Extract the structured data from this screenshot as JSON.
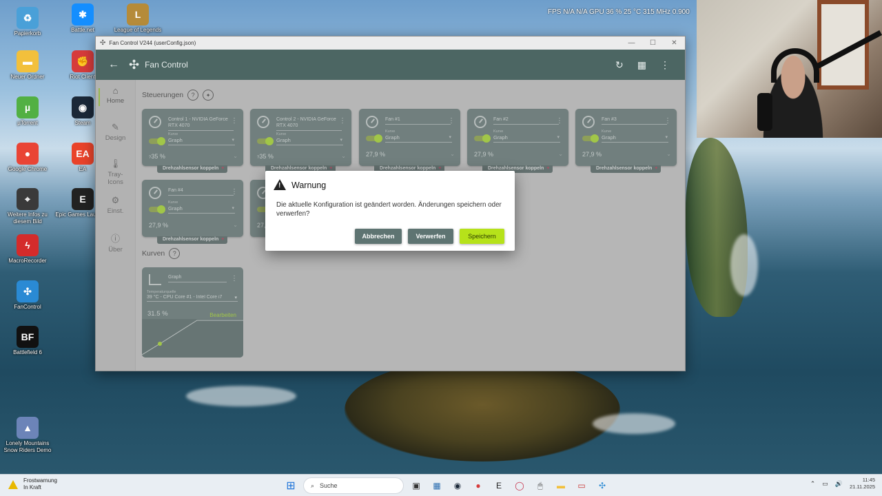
{
  "overlay": {
    "stats_text": "FPS  N/A  N/A    GPU  36 %  25 °C  315 MHz  0.900"
  },
  "desktop_icons": [
    {
      "label": "Papierkorb",
      "color": "#4aa0d8",
      "glyph": "♻"
    },
    {
      "label": "Battle.net",
      "color": "#148eff",
      "glyph": "✱"
    },
    {
      "label": "League of Legends",
      "color": "#b58b3a",
      "glyph": "L"
    },
    {
      "label": "Neuer Ordner",
      "color": "#f2c03c",
      "glyph": "▬"
    },
    {
      "label": "Riot Client",
      "color": "#d63b3b",
      "glyph": "✊"
    },
    {
      "label": "µTorrent",
      "color": "#52b043",
      "glyph": "µ"
    },
    {
      "label": "Steam",
      "color": "#1b2838",
      "glyph": "◉"
    },
    {
      "label": "Google Chrome",
      "color": "#e94435",
      "glyph": "●"
    },
    {
      "label": "EA",
      "color": "#e9432a",
      "glyph": "EA"
    },
    {
      "label": "Weitere Infos zu diesem Bild",
      "color": "#3a3a3a",
      "glyph": "⌖"
    },
    {
      "label": "Epic Games Launcher",
      "color": "#222222",
      "glyph": "E"
    },
    {
      "label": "MacroRecorder",
      "color": "#d42b2b",
      "glyph": "ϟ"
    },
    {
      "label": "FanControl",
      "color": "#2a8ad4",
      "glyph": "✣"
    },
    {
      "label": "Battlefield 6",
      "color": "#111111",
      "glyph": "BF"
    },
    {
      "label": "Lonely Mountains Snow Riders Demo",
      "color": "#6c84b8",
      "glyph": "▲"
    }
  ],
  "window": {
    "title": "Fan Control V244 (userConfig.json)",
    "controls": [
      "—",
      "☐",
      "✕"
    ]
  },
  "appbar": {
    "title": "Fan Control",
    "back": "←",
    "logo": "✣",
    "refresh": "↻",
    "layout": "▦",
    "menu": "⋮"
  },
  "rail": [
    {
      "label": "Home",
      "icon": "⌂"
    },
    {
      "label": "Design",
      "icon": "✎"
    },
    {
      "label": "Tray-Icons",
      "icon": "🌡"
    },
    {
      "label": "Einst.",
      "icon": "⚙"
    },
    {
      "label": "Über",
      "icon": "ⓘ"
    }
  ],
  "sections": {
    "controls_title": "Steuerungen",
    "curves_title": "Kurven",
    "help": "?",
    "wrench": "🔧"
  },
  "controls": [
    {
      "name": "Control 1 - NVIDIA GeForce RTX 4070",
      "kurve_label": "Kurve",
      "curve": "Graph",
      "value": "35 %",
      "prefix": "?",
      "couple": "Drehzahlsensor koppeln"
    },
    {
      "name": "Control 2 - NVIDIA GeForce RTX 4070",
      "kurve_label": "Kurve",
      "curve": "Graph",
      "value": "35 %",
      "prefix": "?",
      "couple": "Drehzahlsensor koppeln"
    },
    {
      "name": "Fan #1",
      "kurve_label": "Kurve",
      "curve": "Graph",
      "value": "27,9 %",
      "couple": "Drehzahlsensor koppeln"
    },
    {
      "name": "Fan #2",
      "kurve_label": "Kurve",
      "curve": "Graph",
      "value": "27,9 %",
      "couple": "Drehzahlsensor koppeln"
    },
    {
      "name": "Fan #3",
      "kurve_label": "Kurve",
      "curve": "Graph",
      "value": "27,9 %",
      "couple": "Drehzahlsensor koppeln"
    },
    {
      "name": "Fan #4",
      "kurve_label": "Kurve",
      "curve": "Graph",
      "value": "27,9 %",
      "couple": "Drehzahlsensor koppeln"
    },
    {
      "name": "",
      "kurve_label": "",
      "curve": "",
      "value": "27,",
      "couple": ""
    }
  ],
  "curve_card": {
    "name": "Graph",
    "temp_label": "Temperaturquelle",
    "temp_source": "39 °C - CPU Core #1 - Intel Core i7",
    "value": "31.5 %",
    "edit": "Bearbeiten"
  },
  "fab": "+",
  "dialog": {
    "title": "Warnung",
    "message": "Die aktuelle Konfiguration ist geändert worden. Änderungen speichern oder verwerfen?",
    "cancel": "Abbrechen",
    "discard": "Verwerfen",
    "save": "Speichern"
  },
  "taskbar": {
    "weather_title": "Frostwarnung",
    "weather_sub": "In Kraft",
    "search_placeholder": "Suche",
    "search_icon": "⌕",
    "start_icon": "⊞",
    "apps": [
      "▣",
      "▦",
      "◉",
      "●",
      "E",
      "◯",
      "🖱",
      "▬",
      "▭",
      "✣"
    ],
    "tray_icons": [
      "⌃",
      "▭",
      "🔊"
    ],
    "time": "11:45",
    "date": "21.11.2025"
  }
}
